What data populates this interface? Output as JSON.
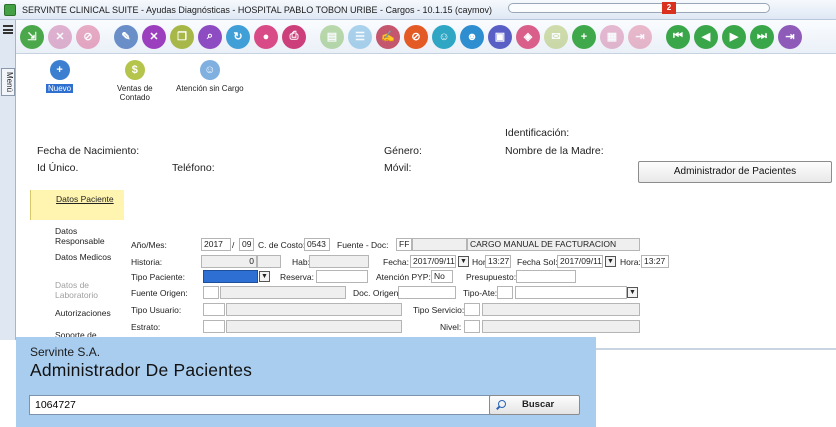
{
  "window": {
    "title": "SERVINTE CLINICAL SUITE - Ayudas Diagnósticas - HOSPITAL PABLO TOBON URIBE - Cargos - 10.1.15 (caymov)",
    "badge": "2"
  },
  "menu": {
    "label": "Menú"
  },
  "toolbar": {
    "buttons": [
      {
        "icon": "green-export-icon",
        "color": "#4aa84a"
      },
      {
        "icon": "trash-icon",
        "color": "#c45b9a"
      },
      {
        "icon": "lock-icon",
        "color": "#d64b80"
      },
      {
        "icon": "edit-icon",
        "color": "#6a8fc8"
      },
      {
        "icon": "cancel-icon",
        "color": "#9b3fbf"
      },
      {
        "icon": "copy-icon",
        "color": "#a8b848"
      },
      {
        "icon": "search-icon",
        "color": "#8d4cc2"
      },
      {
        "icon": "refresh-icon",
        "color": "#3f9fd6"
      },
      {
        "icon": "camera-icon",
        "color": "#d84b86"
      },
      {
        "icon": "print-icon",
        "color": "#cc3f7a"
      },
      {
        "icon": "document-icon",
        "color": "#6fb24a"
      },
      {
        "icon": "list-icon",
        "color": "#4fa3d8"
      },
      {
        "icon": "sign-icon",
        "color": "#c4566d"
      },
      {
        "icon": "no-entry-icon",
        "color": "#e35a25"
      },
      {
        "icon": "user-icon",
        "color": "#2fa7c4"
      },
      {
        "icon": "users-icon",
        "color": "#2e8ed0"
      },
      {
        "icon": "card-icon",
        "color": "#5a5fc6"
      },
      {
        "icon": "eraser-icon",
        "color": "#d95f8a"
      },
      {
        "icon": "note-icon",
        "color": "#a0b848"
      },
      {
        "icon": "add-icon",
        "color": "#3fa84a"
      },
      {
        "icon": "folder-icon",
        "color": "#cf6a9a"
      },
      {
        "icon": "exit-door-icon",
        "color": "#d86a8e"
      },
      {
        "icon": "first-record-icon",
        "color": "#3aa64a"
      },
      {
        "icon": "previous-icon",
        "color": "#3aa64a"
      },
      {
        "icon": "next-icon",
        "color": "#3aa64a"
      },
      {
        "icon": "last-record-icon",
        "color": "#3aa64a"
      },
      {
        "icon": "logout-icon",
        "color": "#8e5bb8"
      }
    ]
  },
  "actions": {
    "nuevo": "Nuevo",
    "ventas_line1": "Ventas de",
    "ventas_line2": "Contado",
    "atencion": "Atención sin Cargo"
  },
  "patient": {
    "identificacion": "Identificación:",
    "fecha_nacimiento": "Fecha de Nacimiento:",
    "genero": "Género:",
    "nombre_madre": "Nombre de la Madre:",
    "id_unico": "Id Único.",
    "telefono": "Teléfono:",
    "movil": "Móvil:",
    "admin_button": "Administrador de Pacientes"
  },
  "sidenav": {
    "datos_paciente": "Datos Paciente",
    "datos_responsable_1": "Datos",
    "datos_responsable_2": "Responsable",
    "datos_medicos": "Datos Medicos",
    "datos_lab_1": "Datos de",
    "datos_lab_2": "Laboratorio",
    "autorizaciones": "Autorizaciones",
    "cut_item": "Soporte de"
  },
  "form": {
    "anio_mes_label": "Año/Mes:",
    "anio": "2017",
    "slash": "/",
    "mes": "09",
    "costo_label": "C. de Costo:",
    "costo": "0543",
    "fuente_doc_label": "Fuente - Doc:",
    "fuente": "FF",
    "cargo_desc": "CARGO MANUAL DE FACTURACION",
    "historia_label": "Historia:",
    "historia": "0",
    "hab_label": "Hab:",
    "fecha_label": "Fecha:",
    "fecha": "2017/09/11",
    "hora_label": "Hora:",
    "hora": "13:27",
    "fecha_sol_label": "Fecha Sol:",
    "fecha_sol": "2017/09/11",
    "hora2_label": "Hora:",
    "hora2": "13:27",
    "tipo_paciente_label": "Tipo Paciente:",
    "reserva_label": "Reserva:",
    "atencion_pyp_label": "Atención PYP:",
    "atencion_pyp": "No",
    "presupuesto_label": "Presupuesto:",
    "fuente_origen_label": "Fuente Origen:",
    "doc_origen_label": "Doc. Origen:",
    "tipo_ate_label": "Tipo-Ate:",
    "tipo_usuario_label": "Tipo Usuario:",
    "tipo_servicio_label": "Tipo Servicio:",
    "estrato_label": "Estrato:",
    "nivel_label": "Nivel:"
  },
  "dialog": {
    "company": "Servinte S.A.",
    "title": "Administrador De Pacientes",
    "search_value": "1064727",
    "search_button": "Buscar"
  }
}
